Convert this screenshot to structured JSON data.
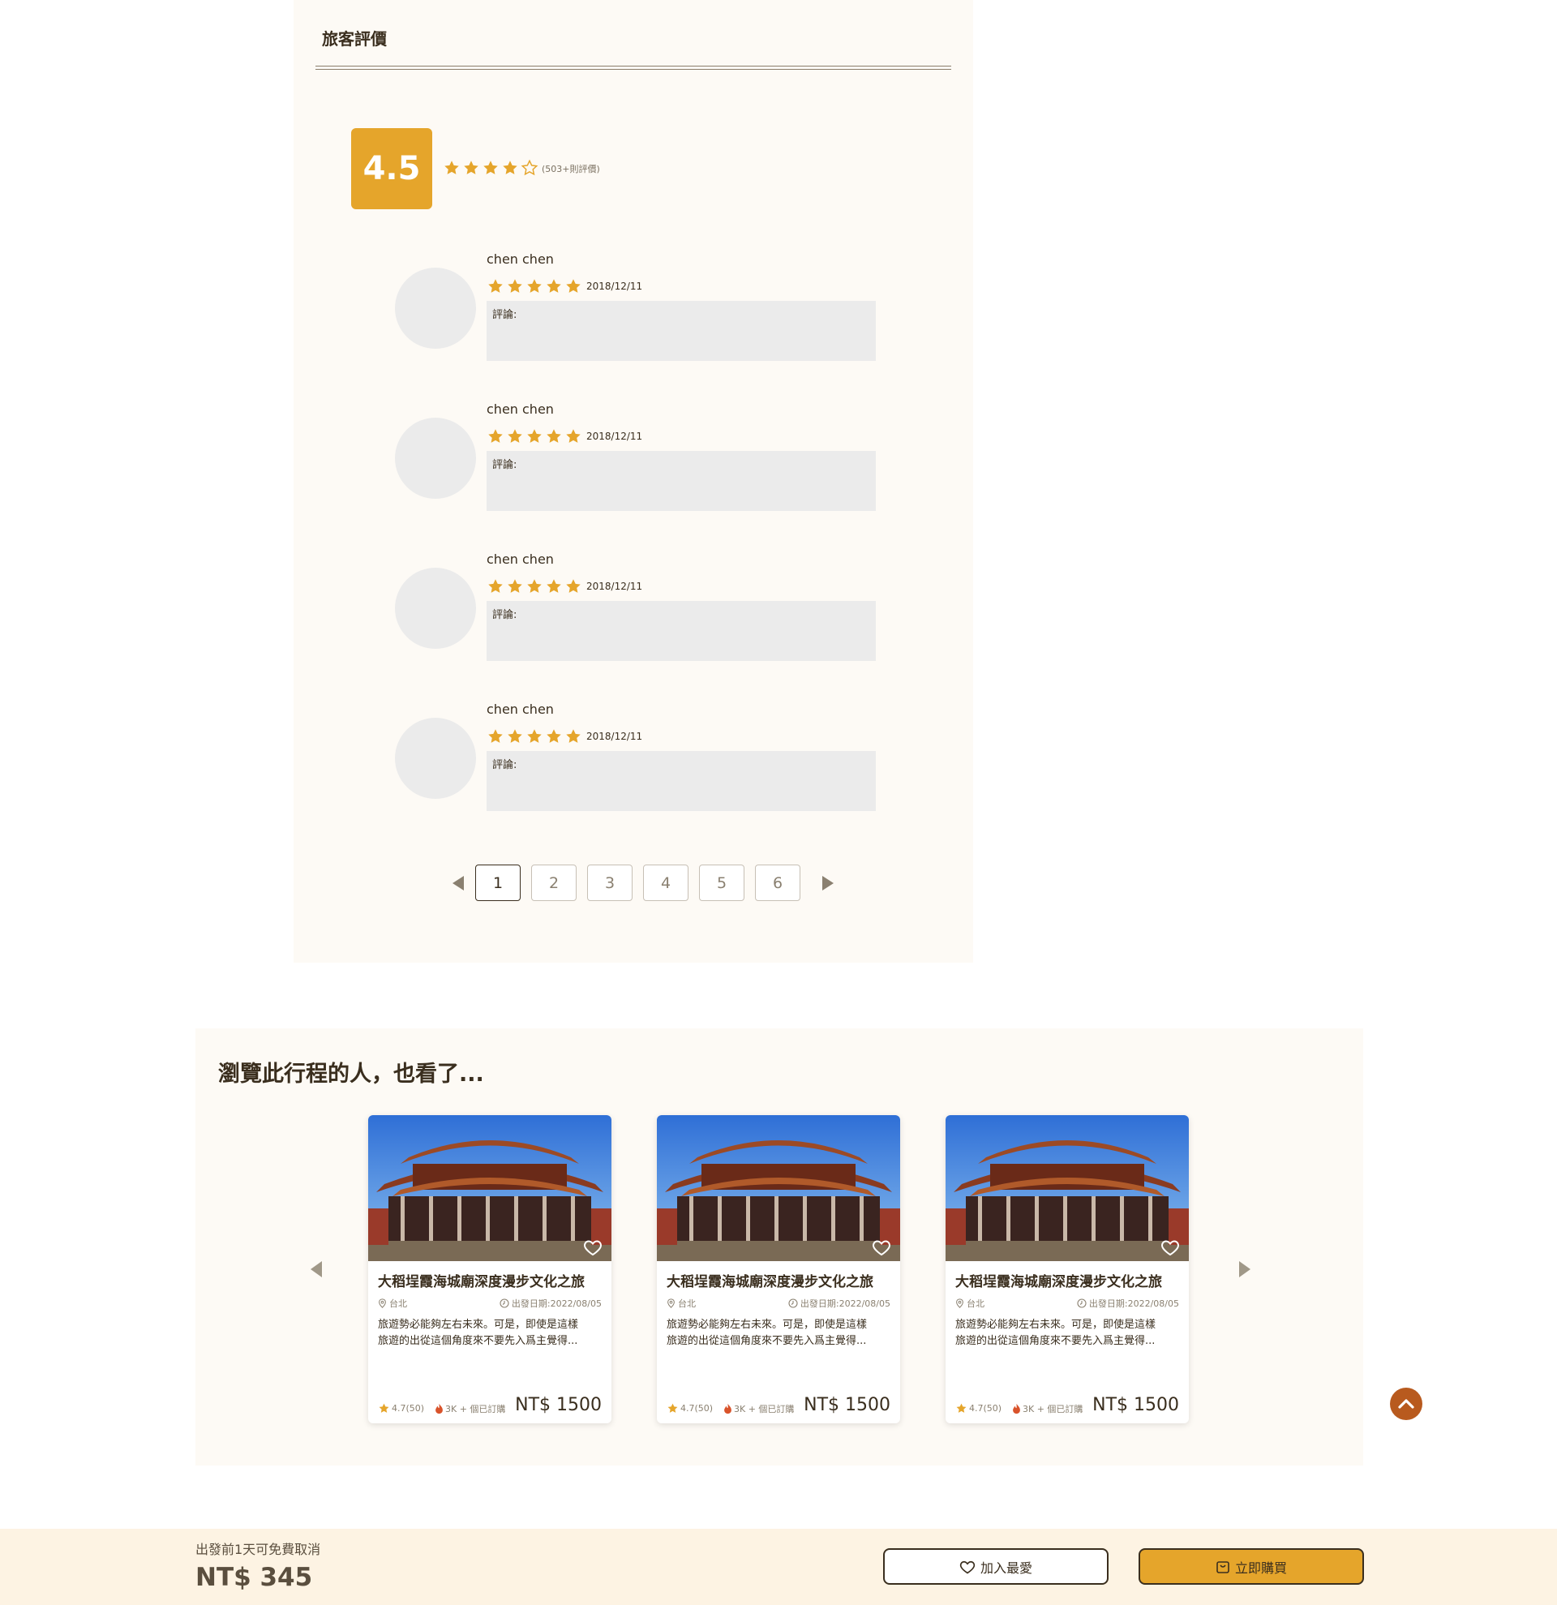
{
  "reviews": {
    "title": "旅客評價",
    "score": "4.5",
    "rating": 4.5,
    "count_text": "(503+則評價)",
    "items": [
      {
        "name": "chen chen",
        "rating": 5,
        "date": "2018/12/11",
        "comment": "評論:"
      },
      {
        "name": "chen chen",
        "rating": 5,
        "date": "2018/12/11",
        "comment": "評論:"
      },
      {
        "name": "chen chen",
        "rating": 5,
        "date": "2018/12/11",
        "comment": "評論:"
      },
      {
        "name": "chen chen",
        "rating": 5,
        "date": "2018/12/11",
        "comment": "評論:"
      }
    ],
    "pagination": {
      "pages": [
        "1",
        "2",
        "3",
        "4",
        "5",
        "6"
      ],
      "current": "1"
    }
  },
  "recommendations": {
    "heading": "瀏覽此行程的人，也看了...",
    "cards": [
      {
        "title": "大稻埕霞海城廟深度漫步文化之旅",
        "location": "台北",
        "departure": "出發日期:2022/08/05",
        "desc_line1": "旅遊勢必能夠左右未來。可是，即使是這樣",
        "desc_line2": "旅遊的出從這個角度來不要先入爲主覺得...",
        "rating": "4.7(50)",
        "sold": "3K + 個已訂購",
        "price": "NT$ 1500"
      },
      {
        "title": "大稻埕霞海城廟深度漫步文化之旅",
        "location": "台北",
        "departure": "出發日期:2022/08/05",
        "desc_line1": "旅遊勢必能夠左右未來。可是，即使是這樣",
        "desc_line2": "旅遊的出從這個角度來不要先入爲主覺得...",
        "rating": "4.7(50)",
        "sold": "3K + 個已訂購",
        "price": "NT$ 1500"
      },
      {
        "title": "大稻埕霞海城廟深度漫步文化之旅",
        "location": "台北",
        "departure": "出發日期:2022/08/05",
        "desc_line1": "旅遊勢必能夠左右未來。可是，即使是這樣",
        "desc_line2": "旅遊的出從這個角度來不要先入爲主覺得...",
        "rating": "4.7(50)",
        "sold": "3K + 個已訂購",
        "price": "NT$ 1500"
      }
    ]
  },
  "bottom_bar": {
    "cancel_note": "出發前1天可免費取消",
    "price": "NT$ 345",
    "favorite_label": "加入最愛",
    "buy_label": "立即購買"
  },
  "colors": {
    "accent": "#e5a52b",
    "panel_bg": "#fdfaf5",
    "bar_bg": "#fdf3e3",
    "back_top": "#b85a1e",
    "fire": "#d9532b"
  },
  "icons": {
    "star": "star-icon",
    "heart": "heart-icon",
    "location": "location-pin-icon",
    "clock": "clock-icon",
    "fire": "fire-icon",
    "bag": "shopping-bag-icon",
    "arrow_up": "chevron-up-icon"
  }
}
